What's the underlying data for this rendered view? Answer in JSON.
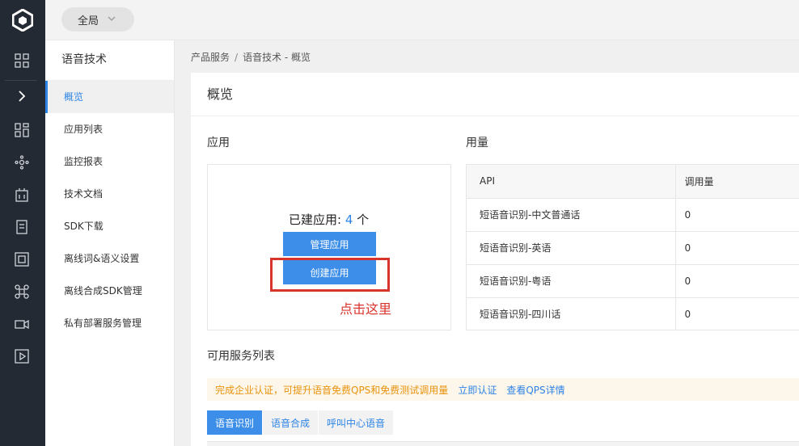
{
  "topbar": {
    "scope_label": "全局"
  },
  "sidenav": {
    "title": "语音技术",
    "items": [
      {
        "label": "概览",
        "active": true
      },
      {
        "label": "应用列表"
      },
      {
        "label": "监控报表"
      },
      {
        "label": "技术文档"
      },
      {
        "label": "SDK下载"
      },
      {
        "label": "离线词&语义设置"
      },
      {
        "label": "离线合成SDK管理"
      },
      {
        "label": "私有部署服务管理"
      }
    ]
  },
  "breadcrumb": {
    "root": "产品服务",
    "separator": "/",
    "current": "语音技术 - 概览"
  },
  "panel": {
    "title": "概览"
  },
  "apps": {
    "label": "应用",
    "count_prefix": "已建应用:",
    "count": "4",
    "count_suffix": "个",
    "manage_button": "管理应用",
    "create_button": "创建应用",
    "annotation": "点击这里"
  },
  "usage": {
    "label": "用量",
    "columns": [
      "API",
      "调用量"
    ],
    "rows": [
      {
        "api": "短语音识别-中文普通话",
        "calls": "0"
      },
      {
        "api": "短语音识别-英语",
        "calls": "0"
      },
      {
        "api": "短语音识别-粤语",
        "calls": "0"
      },
      {
        "api": "短语音识别-四川话",
        "calls": "0"
      }
    ]
  },
  "services": {
    "label": "可用服务列表",
    "notice_text": "完成企业认证，可提升语音免费QPS和免费测试调用量",
    "notice_link1": "立即认证",
    "notice_link2": "查看QPS详情",
    "tabs": [
      {
        "label": "语音识别",
        "active": true
      },
      {
        "label": "语音合成"
      },
      {
        "label": "呼叫中心语音"
      }
    ]
  },
  "colors": {
    "accent": "#2e84e6",
    "button": "#3c8ee8",
    "annotation": "#d9342b",
    "warning": "#e8930c"
  }
}
